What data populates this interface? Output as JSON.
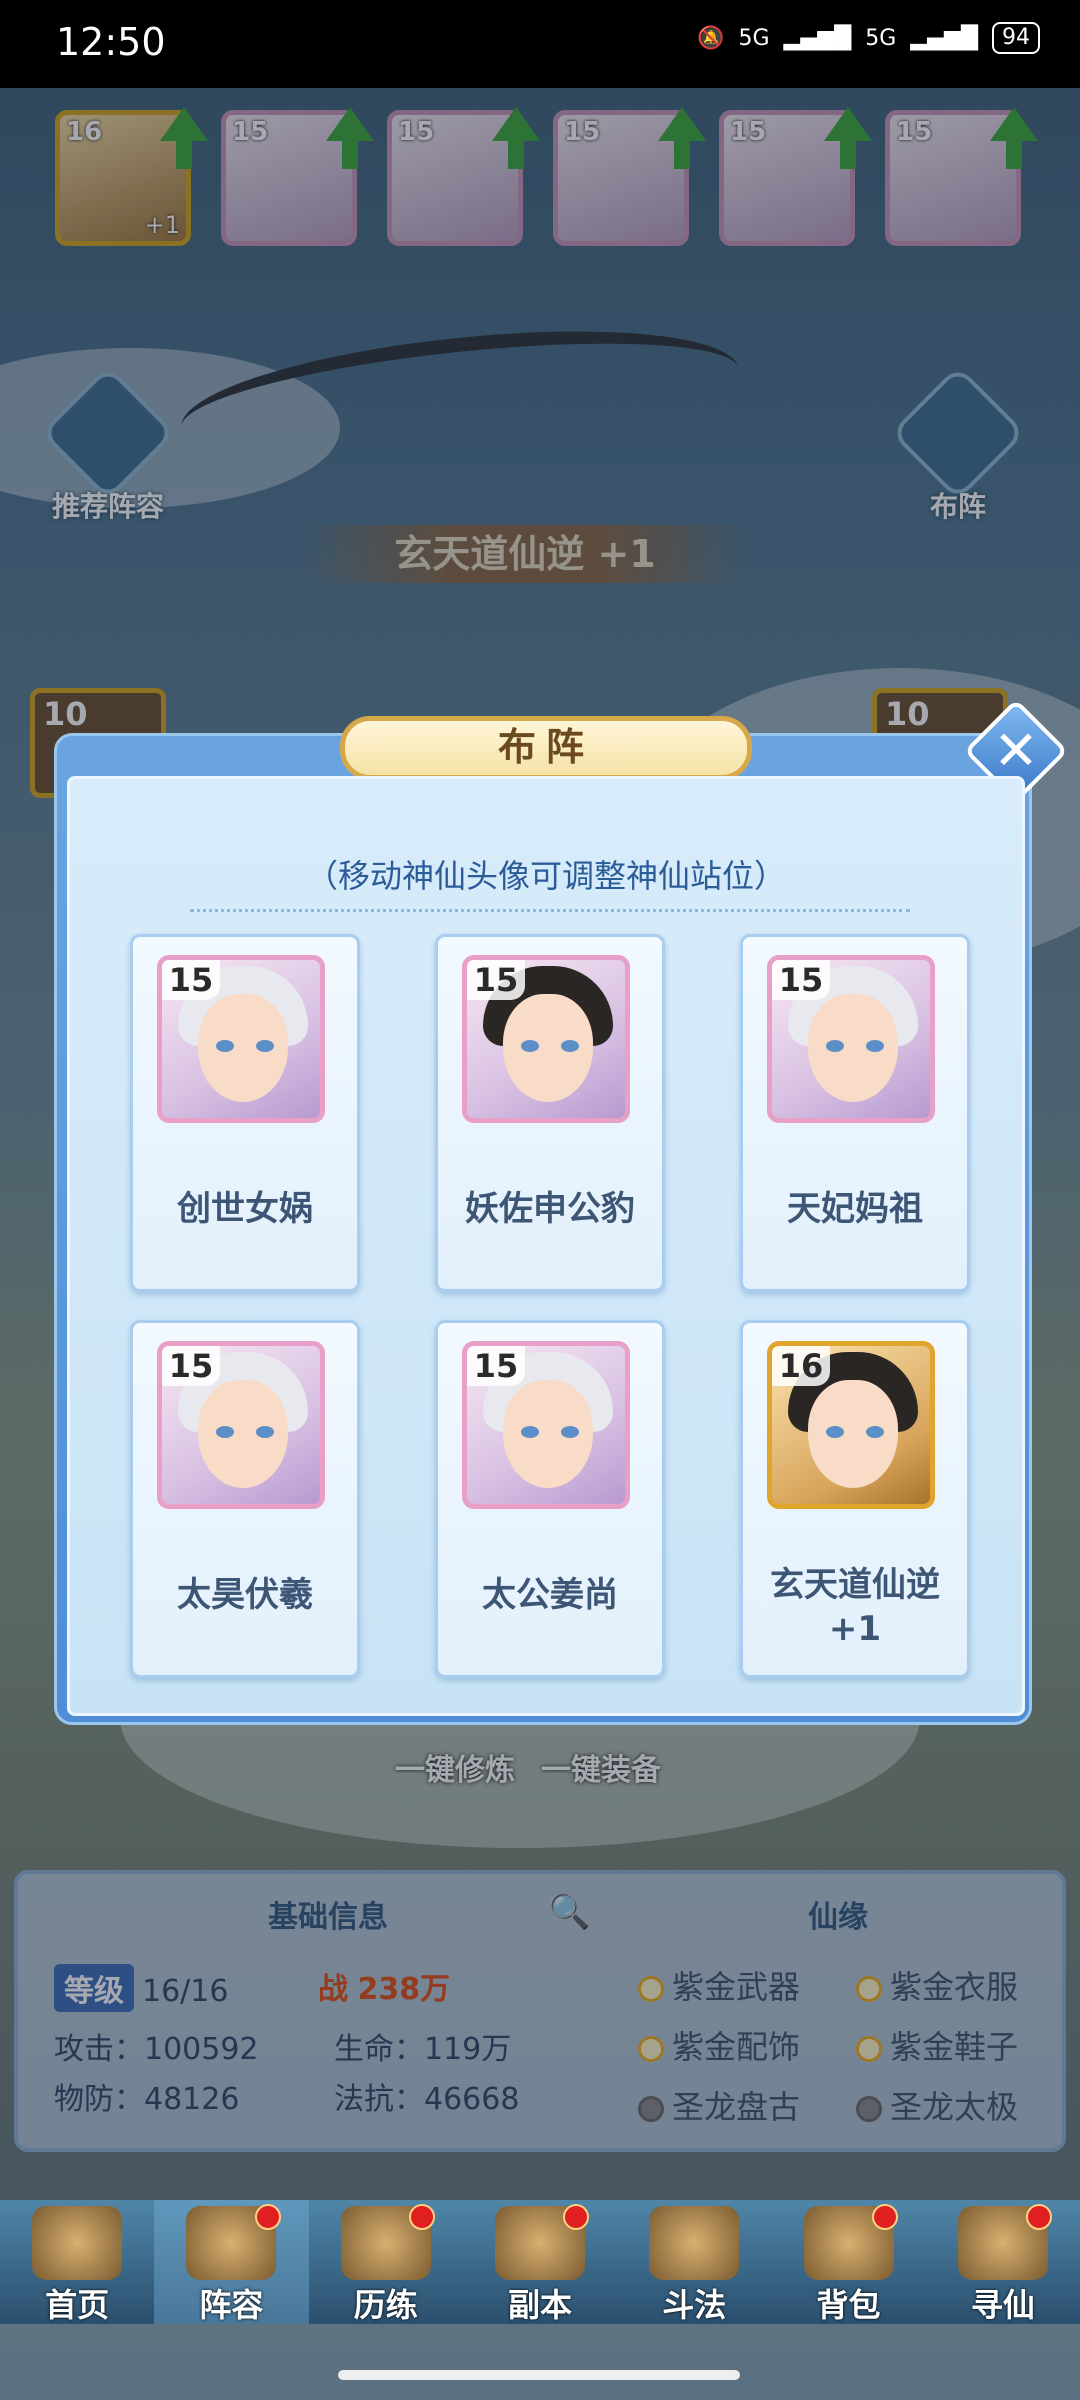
{
  "status_bar": {
    "time": "12:50",
    "network": "5G",
    "network2": "5G",
    "battery": "94"
  },
  "top_row": [
    {
      "level": "16",
      "plus": "+1",
      "frame": "gold"
    },
    {
      "level": "15",
      "plus": "",
      "frame": "purple"
    },
    {
      "level": "15",
      "plus": "",
      "frame": "purple"
    },
    {
      "level": "15",
      "plus": "",
      "frame": "purple"
    },
    {
      "level": "15",
      "plus": "",
      "frame": "purple"
    },
    {
      "level": "15",
      "plus": "",
      "frame": "purple"
    }
  ],
  "side": {
    "recommend_label": "推荐阵容",
    "formation_label": "布阵"
  },
  "hero_name_bar": "玄天道仙逆 +1",
  "mid_cards": {
    "left_level": "10",
    "right_level": "10"
  },
  "bottom_buttons": {
    "cultivate": "一键修炼",
    "equip": "一键装备"
  },
  "info": {
    "basic_header": "基础信息",
    "bond_header": "仙缘",
    "level_label": "等级",
    "level_value": "16/16",
    "power_icon": "战",
    "power_value": "238万",
    "attack_label": "攻击：",
    "attack_value": "100592",
    "hp_label": "生命：",
    "hp_value": "119万",
    "pdef_label": "物防：",
    "pdef_value": "48126",
    "mres_label": "法抗：",
    "mres_value": "46668",
    "bonds": [
      {
        "label": "紫金武器",
        "active": true
      },
      {
        "label": "紫金衣服",
        "active": true
      },
      {
        "label": "紫金配饰",
        "active": true
      },
      {
        "label": "紫金鞋子",
        "active": true
      },
      {
        "label": "圣龙盘古",
        "active": false
      },
      {
        "label": "圣龙太极",
        "active": false
      }
    ]
  },
  "dialog": {
    "title": "布阵",
    "close_icon": "close-icon",
    "hint": "（移动神仙头像可调整神仙站位）",
    "slots": [
      {
        "level": "15",
        "name": "创世女娲",
        "frame": "purple",
        "hair": "light"
      },
      {
        "level": "15",
        "name": "妖佐申公豹",
        "frame": "purple",
        "hair": "dark"
      },
      {
        "level": "15",
        "name": "天妃妈祖",
        "frame": "purple",
        "hair": "light"
      },
      {
        "level": "15",
        "name": "太昊伏羲",
        "frame": "purple",
        "hair": "light"
      },
      {
        "level": "15",
        "name": "太公姜尚",
        "frame": "purple",
        "hair": "light"
      },
      {
        "level": "16",
        "name": "玄天道仙逆\n+1",
        "frame": "gold",
        "hair": "dark"
      }
    ]
  },
  "nav": [
    {
      "label": "首页",
      "badge": false
    },
    {
      "label": "阵容",
      "badge": true,
      "active": true
    },
    {
      "label": "历练",
      "badge": true
    },
    {
      "label": "副本",
      "badge": true
    },
    {
      "label": "斗法",
      "badge": false
    },
    {
      "label": "背包",
      "badge": true
    },
    {
      "label": "寻仙",
      "badge": true
    }
  ]
}
